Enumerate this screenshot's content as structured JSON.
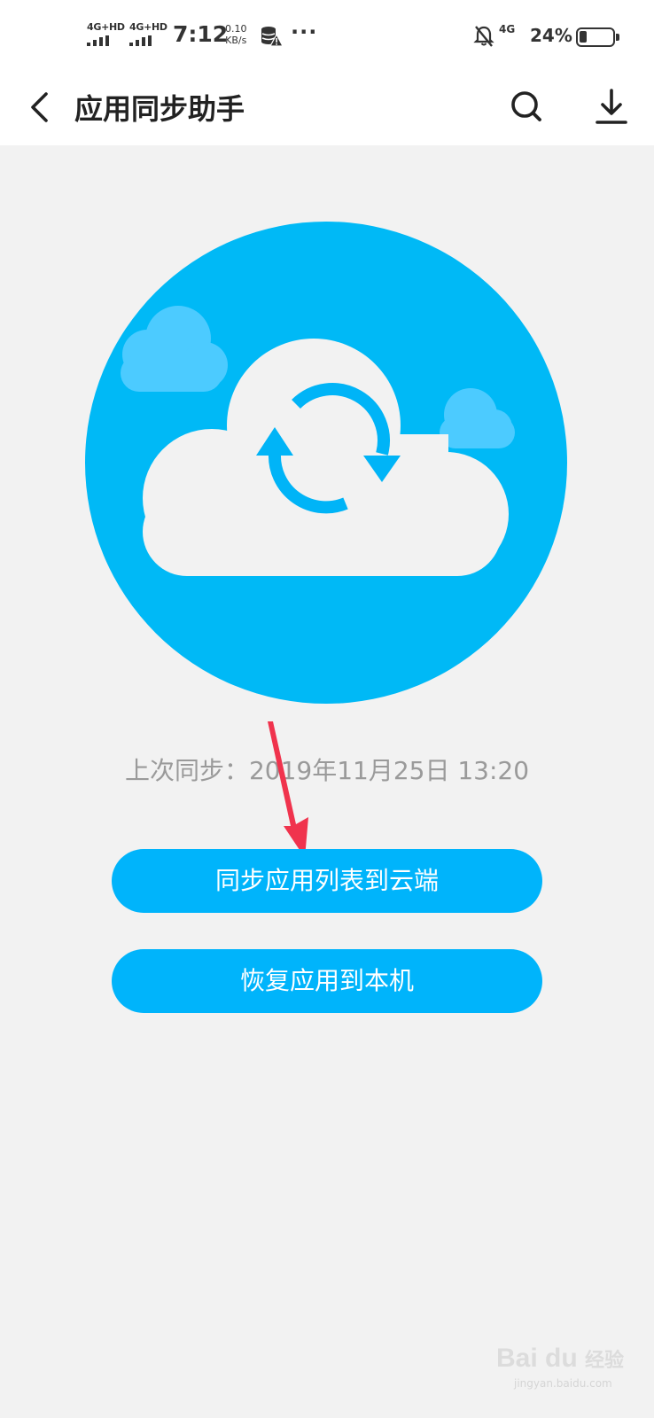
{
  "status_bar": {
    "sim1_label": "4G+HD",
    "sim2_label": "4G+HD",
    "time": "7:12",
    "speed_value": "0.10",
    "speed_unit": "KB/s",
    "more": "···",
    "network_label": "4G",
    "battery_percent_text": "24%",
    "battery_level": 0.24
  },
  "app_bar": {
    "title": "应用同步助手"
  },
  "sync": {
    "last_sync": "上次同步：2019年11月25日 13:20"
  },
  "buttons": {
    "sync_to_cloud": "同步应用列表到云端",
    "restore_to_device": "恢复应用到本机"
  },
  "watermark": {
    "brand": "Bai du",
    "suffix": "经验",
    "domain": "jingyan.baidu.com"
  },
  "colors": {
    "accent": "#00b4fb",
    "annotation_arrow": "#f0334d",
    "background": "#f2f2f2"
  }
}
